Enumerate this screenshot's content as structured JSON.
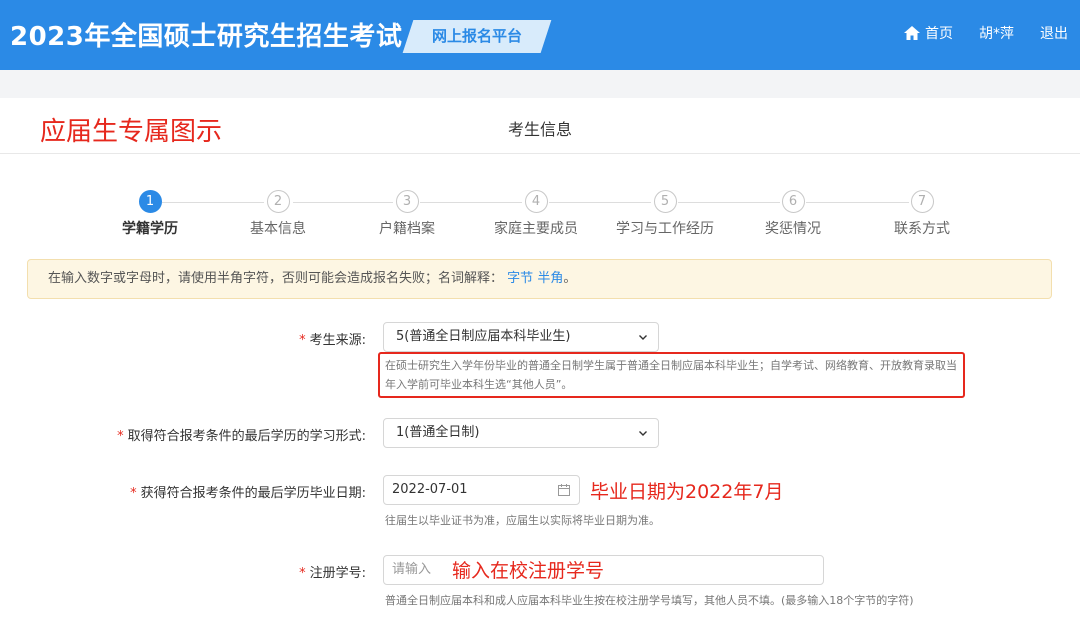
{
  "header": {
    "site_title": "2023年全国硕士研究生招生考试",
    "platform_tag": "网上报名平台",
    "nav": {
      "home": "首页",
      "user": "胡*萍",
      "logout": "退出"
    }
  },
  "overlay_title": "应届生专属图示",
  "section_title": "考生信息",
  "steps": [
    {
      "num": "1",
      "label": "学籍学历"
    },
    {
      "num": "2",
      "label": "基本信息"
    },
    {
      "num": "3",
      "label": "户籍档案"
    },
    {
      "num": "4",
      "label": "家庭主要成员"
    },
    {
      "num": "5",
      "label": "学习与工作经历"
    },
    {
      "num": "6",
      "label": "奖惩情况"
    },
    {
      "num": "7",
      "label": "联系方式"
    }
  ],
  "notice": {
    "text": "在输入数字或字母时，请使用半角字符，否则可能会造成报名失败；名词解释：",
    "link_bytes": "字节",
    "link_halfwidth": "半角",
    "end": "。"
  },
  "form": {
    "required_mark": "*",
    "source": {
      "label": "考生来源:",
      "value": "5(普通全日制应届本科毕业生)",
      "hint": "在硕士研究生入学年份毕业的普通全日制学生属于普通全日制应届本科毕业生；自学考试、网络教育、开放教育录取当年入学前可毕业本科生选“其他人员”。"
    },
    "study_form": {
      "label": "取得符合报考条件的最后学历的学习形式:",
      "value": "1(普通全日制)"
    },
    "grad_date": {
      "label": "获得符合报考条件的最后学历毕业日期:",
      "value": "2022-07-01",
      "hint": "往届生以毕业证书为准，应届生以实际将毕业日期为准。",
      "annotation": "毕业日期为2022年7月"
    },
    "reg_no": {
      "label": "注册学号:",
      "placeholder": "请输入",
      "annotation": "输入在校注册学号",
      "hint": "普通全日制应届本科和成人应届本科毕业生按在校注册学号填写，其他人员不填。(最多输入18个字节的字符)"
    }
  },
  "colors": {
    "primary": "#2b8ae6",
    "annotation_red": "#e6281d",
    "notice_bg": "#fdf6e3"
  }
}
